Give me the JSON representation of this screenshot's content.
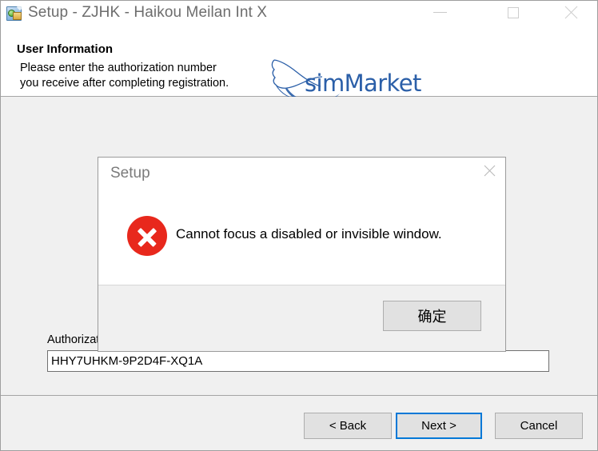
{
  "window": {
    "title": "Setup - ZJHK - Haikou Meilan Int X",
    "icon": "installer-icon",
    "controls": {
      "minimize": "minimize-icon",
      "maximize": "maximize-icon",
      "close": "close-icon"
    }
  },
  "header": {
    "title": "User Information",
    "description": "Please enter the authorization number\nyou receive after completing registration.",
    "brand": {
      "text_light": "sim",
      "text_bold": "Market",
      "color": "#2b5fa8",
      "mark": "bird-wing-logo"
    }
  },
  "content": {
    "auth_label": "Authorization number:",
    "auth_value": "HHY7UHKM-9P2D4F-XQ1A",
    "auth_placeholder": ""
  },
  "footer": {
    "back_label": "< Back",
    "next_label": "Next >",
    "cancel_label": "Cancel",
    "focus_color": "#0078d7"
  },
  "dialog": {
    "title": "Setup",
    "close": "close-icon",
    "icon": "error-x-icon",
    "icon_color": "#e8281c",
    "message": "Cannot focus a disabled or invisible window.",
    "ok_label": "确定"
  }
}
